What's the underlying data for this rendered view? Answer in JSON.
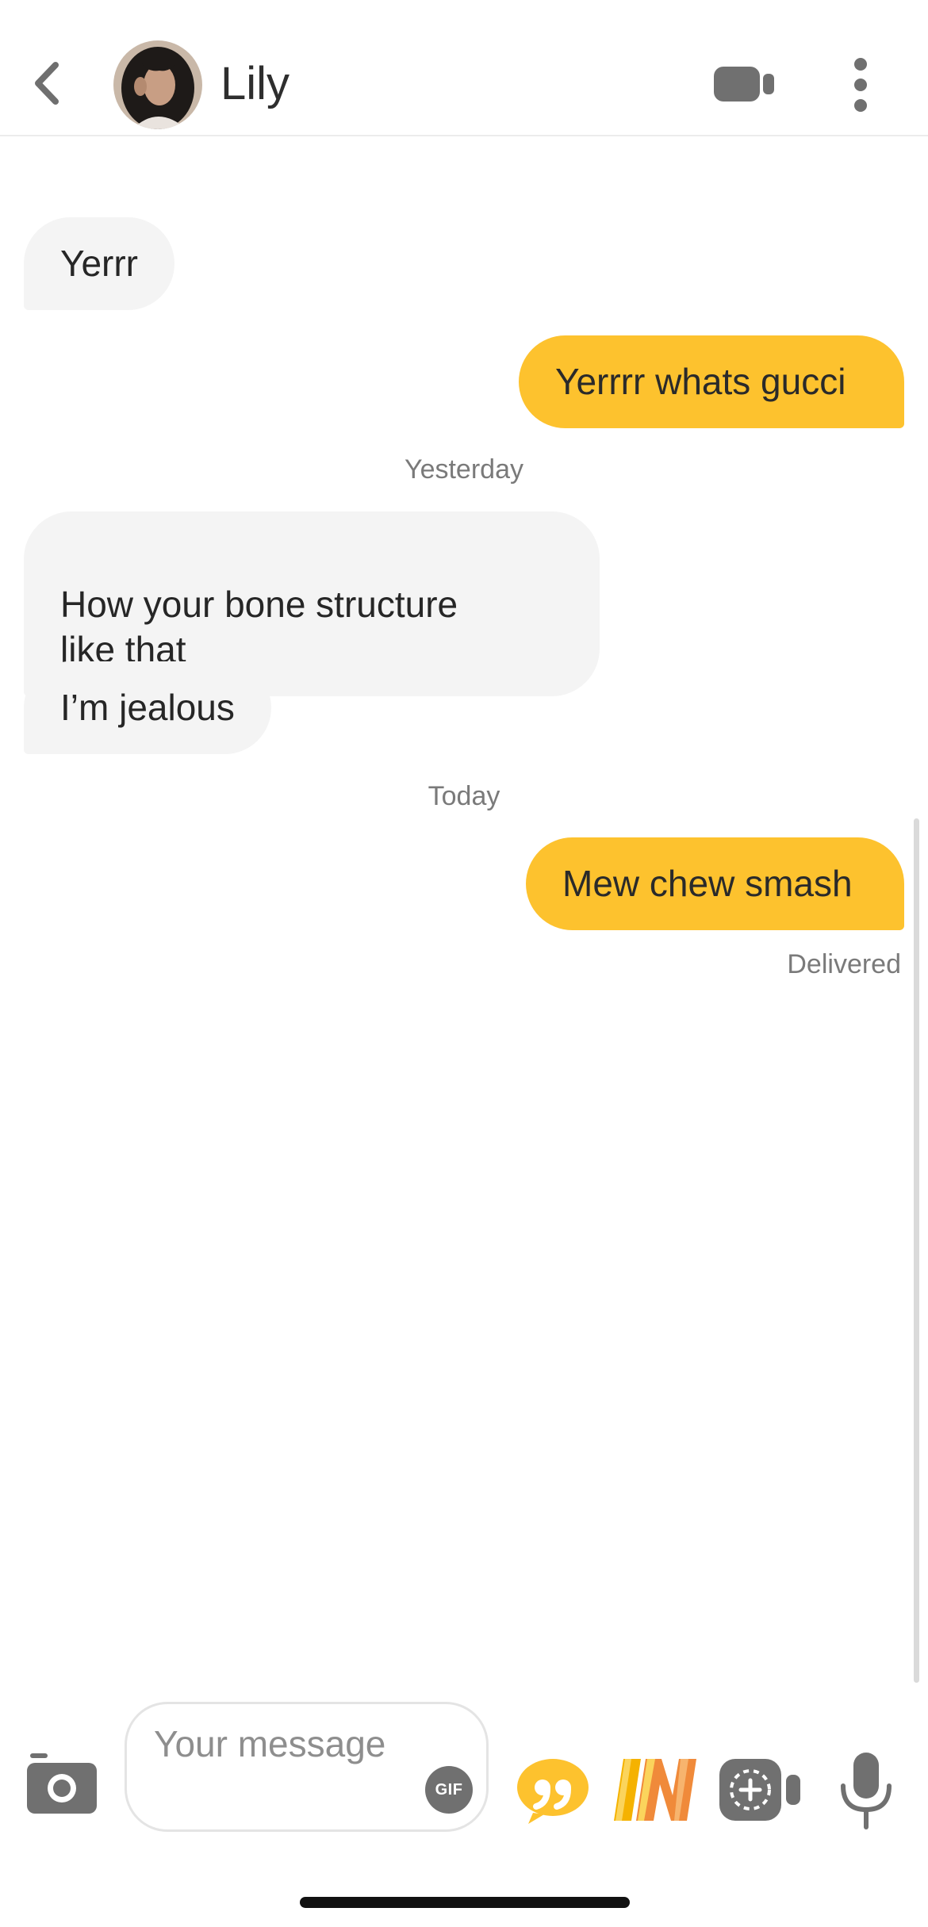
{
  "contact": {
    "name": "Lily"
  },
  "messages": [
    {
      "direction": "in",
      "text": "Yerrr"
    },
    {
      "direction": "out",
      "text": "Yerrrr whats gucci"
    },
    {
      "direction": "separator",
      "text": "Yesterday"
    },
    {
      "direction": "in",
      "text": "How your bone structure\nlike that"
    },
    {
      "direction": "in",
      "text": "I’m jealous"
    },
    {
      "direction": "separator",
      "text": "Today"
    },
    {
      "direction": "out",
      "text": "Mew chew smash"
    }
  ],
  "status": {
    "delivered": "Delivered"
  },
  "composer": {
    "placeholder": "Your message",
    "gif_label": "GIF"
  },
  "icons": {
    "back": "chevron-left-icon",
    "video_call": "video-camera-icon",
    "more": "more-vertical-icon",
    "camera": "camera-icon",
    "quote": "quote-icon",
    "in_feature": "in-icon",
    "video_note": "video-note-icon",
    "mic": "microphone-icon"
  },
  "colors": {
    "accent": "#fdc22e",
    "incoming_bubble": "#f4f4f4",
    "icon_gray": "#707070"
  }
}
